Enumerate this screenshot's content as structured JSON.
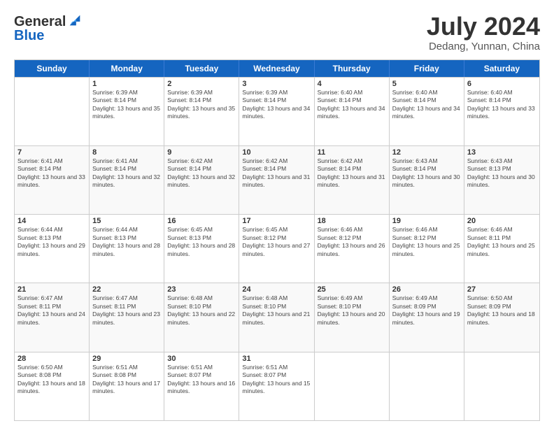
{
  "header": {
    "logo_general": "General",
    "logo_blue": "Blue",
    "month_title": "July 2024",
    "location": "Dedang, Yunnan, China"
  },
  "calendar": {
    "days_of_week": [
      "Sunday",
      "Monday",
      "Tuesday",
      "Wednesday",
      "Thursday",
      "Friday",
      "Saturday"
    ],
    "weeks": [
      [
        {
          "day": "",
          "sunrise": "",
          "sunset": "",
          "daylight": "",
          "empty": true
        },
        {
          "day": "1",
          "sunrise": "Sunrise: 6:39 AM",
          "sunset": "Sunset: 8:14 PM",
          "daylight": "Daylight: 13 hours and 35 minutes."
        },
        {
          "day": "2",
          "sunrise": "Sunrise: 6:39 AM",
          "sunset": "Sunset: 8:14 PM",
          "daylight": "Daylight: 13 hours and 35 minutes."
        },
        {
          "day": "3",
          "sunrise": "Sunrise: 6:39 AM",
          "sunset": "Sunset: 8:14 PM",
          "daylight": "Daylight: 13 hours and 34 minutes."
        },
        {
          "day": "4",
          "sunrise": "Sunrise: 6:40 AM",
          "sunset": "Sunset: 8:14 PM",
          "daylight": "Daylight: 13 hours and 34 minutes."
        },
        {
          "day": "5",
          "sunrise": "Sunrise: 6:40 AM",
          "sunset": "Sunset: 8:14 PM",
          "daylight": "Daylight: 13 hours and 34 minutes."
        },
        {
          "day": "6",
          "sunrise": "Sunrise: 6:40 AM",
          "sunset": "Sunset: 8:14 PM",
          "daylight": "Daylight: 13 hours and 33 minutes."
        }
      ],
      [
        {
          "day": "7",
          "sunrise": "Sunrise: 6:41 AM",
          "sunset": "Sunset: 8:14 PM",
          "daylight": "Daylight: 13 hours and 33 minutes."
        },
        {
          "day": "8",
          "sunrise": "Sunrise: 6:41 AM",
          "sunset": "Sunset: 8:14 PM",
          "daylight": "Daylight: 13 hours and 32 minutes."
        },
        {
          "day": "9",
          "sunrise": "Sunrise: 6:42 AM",
          "sunset": "Sunset: 8:14 PM",
          "daylight": "Daylight: 13 hours and 32 minutes."
        },
        {
          "day": "10",
          "sunrise": "Sunrise: 6:42 AM",
          "sunset": "Sunset: 8:14 PM",
          "daylight": "Daylight: 13 hours and 31 minutes."
        },
        {
          "day": "11",
          "sunrise": "Sunrise: 6:42 AM",
          "sunset": "Sunset: 8:14 PM",
          "daylight": "Daylight: 13 hours and 31 minutes."
        },
        {
          "day": "12",
          "sunrise": "Sunrise: 6:43 AM",
          "sunset": "Sunset: 8:14 PM",
          "daylight": "Daylight: 13 hours and 30 minutes."
        },
        {
          "day": "13",
          "sunrise": "Sunrise: 6:43 AM",
          "sunset": "Sunset: 8:13 PM",
          "daylight": "Daylight: 13 hours and 30 minutes."
        }
      ],
      [
        {
          "day": "14",
          "sunrise": "Sunrise: 6:44 AM",
          "sunset": "Sunset: 8:13 PM",
          "daylight": "Daylight: 13 hours and 29 minutes."
        },
        {
          "day": "15",
          "sunrise": "Sunrise: 6:44 AM",
          "sunset": "Sunset: 8:13 PM",
          "daylight": "Daylight: 13 hours and 28 minutes."
        },
        {
          "day": "16",
          "sunrise": "Sunrise: 6:45 AM",
          "sunset": "Sunset: 8:13 PM",
          "daylight": "Daylight: 13 hours and 28 minutes."
        },
        {
          "day": "17",
          "sunrise": "Sunrise: 6:45 AM",
          "sunset": "Sunset: 8:12 PM",
          "daylight": "Daylight: 13 hours and 27 minutes."
        },
        {
          "day": "18",
          "sunrise": "Sunrise: 6:46 AM",
          "sunset": "Sunset: 8:12 PM",
          "daylight": "Daylight: 13 hours and 26 minutes."
        },
        {
          "day": "19",
          "sunrise": "Sunrise: 6:46 AM",
          "sunset": "Sunset: 8:12 PM",
          "daylight": "Daylight: 13 hours and 25 minutes."
        },
        {
          "day": "20",
          "sunrise": "Sunrise: 6:46 AM",
          "sunset": "Sunset: 8:11 PM",
          "daylight": "Daylight: 13 hours and 25 minutes."
        }
      ],
      [
        {
          "day": "21",
          "sunrise": "Sunrise: 6:47 AM",
          "sunset": "Sunset: 8:11 PM",
          "daylight": "Daylight: 13 hours and 24 minutes."
        },
        {
          "day": "22",
          "sunrise": "Sunrise: 6:47 AM",
          "sunset": "Sunset: 8:11 PM",
          "daylight": "Daylight: 13 hours and 23 minutes."
        },
        {
          "day": "23",
          "sunrise": "Sunrise: 6:48 AM",
          "sunset": "Sunset: 8:10 PM",
          "daylight": "Daylight: 13 hours and 22 minutes."
        },
        {
          "day": "24",
          "sunrise": "Sunrise: 6:48 AM",
          "sunset": "Sunset: 8:10 PM",
          "daylight": "Daylight: 13 hours and 21 minutes."
        },
        {
          "day": "25",
          "sunrise": "Sunrise: 6:49 AM",
          "sunset": "Sunset: 8:10 PM",
          "daylight": "Daylight: 13 hours and 20 minutes."
        },
        {
          "day": "26",
          "sunrise": "Sunrise: 6:49 AM",
          "sunset": "Sunset: 8:09 PM",
          "daylight": "Daylight: 13 hours and 19 minutes."
        },
        {
          "day": "27",
          "sunrise": "Sunrise: 6:50 AM",
          "sunset": "Sunset: 8:09 PM",
          "daylight": "Daylight: 13 hours and 18 minutes."
        }
      ],
      [
        {
          "day": "28",
          "sunrise": "Sunrise: 6:50 AM",
          "sunset": "Sunset: 8:08 PM",
          "daylight": "Daylight: 13 hours and 18 minutes."
        },
        {
          "day": "29",
          "sunrise": "Sunrise: 6:51 AM",
          "sunset": "Sunset: 8:08 PM",
          "daylight": "Daylight: 13 hours and 17 minutes."
        },
        {
          "day": "30",
          "sunrise": "Sunrise: 6:51 AM",
          "sunset": "Sunset: 8:07 PM",
          "daylight": "Daylight: 13 hours and 16 minutes."
        },
        {
          "day": "31",
          "sunrise": "Sunrise: 6:51 AM",
          "sunset": "Sunset: 8:07 PM",
          "daylight": "Daylight: 13 hours and 15 minutes."
        },
        {
          "day": "",
          "sunrise": "",
          "sunset": "",
          "daylight": "",
          "empty": true
        },
        {
          "day": "",
          "sunrise": "",
          "sunset": "",
          "daylight": "",
          "empty": true
        },
        {
          "day": "",
          "sunrise": "",
          "sunset": "",
          "daylight": "",
          "empty": true
        }
      ]
    ]
  }
}
